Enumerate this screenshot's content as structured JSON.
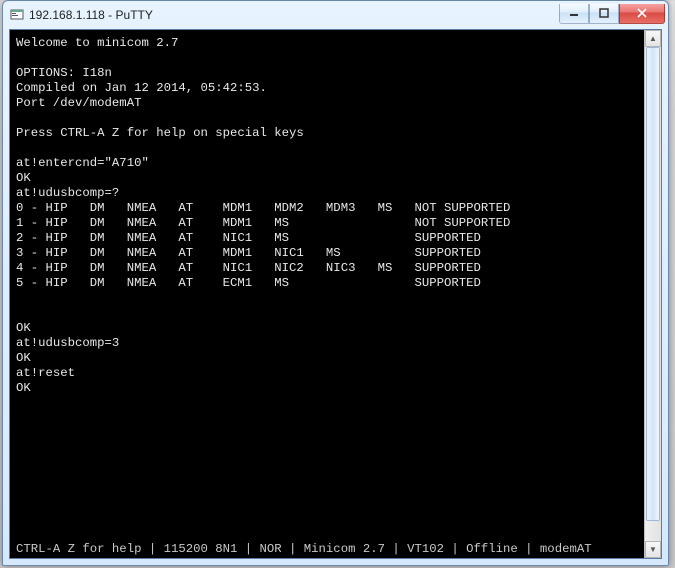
{
  "window": {
    "title": "192.168.1.118 - PuTTY",
    "icon_name": "putty-icon",
    "buttons": {
      "minimize": "–",
      "maximize": "▢",
      "close": "X"
    }
  },
  "terminal": {
    "welcome": "Welcome to minicom 2.7",
    "options": "OPTIONS: I18n",
    "compiled": "Compiled on Jan 12 2014, 05:42:53.",
    "port": "Port /dev/modemAT",
    "help_hint": "Press CTRL-A Z for help on special keys",
    "session": {
      "cmd1": "at!entercnd=\"A710\"",
      "rsp1": "OK",
      "cmd2": "at!udusbcomp=?",
      "table": {
        "rows": [
          {
            "idx": "0",
            "cols": [
              "HIP",
              "DM",
              "NMEA",
              "AT",
              "MDM1",
              "MDM2",
              "MDM3",
              "MS"
            ],
            "status": "NOT SUPPORTED"
          },
          {
            "idx": "1",
            "cols": [
              "HIP",
              "DM",
              "NMEA",
              "AT",
              "MDM1",
              "MS",
              "",
              ""
            ],
            "status": "NOT SUPPORTED"
          },
          {
            "idx": "2",
            "cols": [
              "HIP",
              "DM",
              "NMEA",
              "AT",
              "NIC1",
              "MS",
              "",
              ""
            ],
            "status": "SUPPORTED"
          },
          {
            "idx": "3",
            "cols": [
              "HIP",
              "DM",
              "NMEA",
              "AT",
              "MDM1",
              "NIC1",
              "MS",
              ""
            ],
            "status": "SUPPORTED"
          },
          {
            "idx": "4",
            "cols": [
              "HIP",
              "DM",
              "NMEA",
              "AT",
              "NIC1",
              "NIC2",
              "NIC3",
              "MS"
            ],
            "status": "SUPPORTED"
          },
          {
            "idx": "5",
            "cols": [
              "HIP",
              "DM",
              "NMEA",
              "AT",
              "ECM1",
              "MS",
              "",
              ""
            ],
            "status": "SUPPORTED"
          }
        ]
      },
      "rsp2": "OK",
      "cmd3": "at!udusbcomp=3",
      "rsp3": "OK",
      "cmd4": "at!reset",
      "rsp4": "OK"
    },
    "statusbar": "CTRL-A Z for help | 115200 8N1 | NOR | Minicom 2.7 | VT102 | Offline | modemAT"
  },
  "scrollbar": {
    "up": "▲",
    "down": "▼"
  }
}
